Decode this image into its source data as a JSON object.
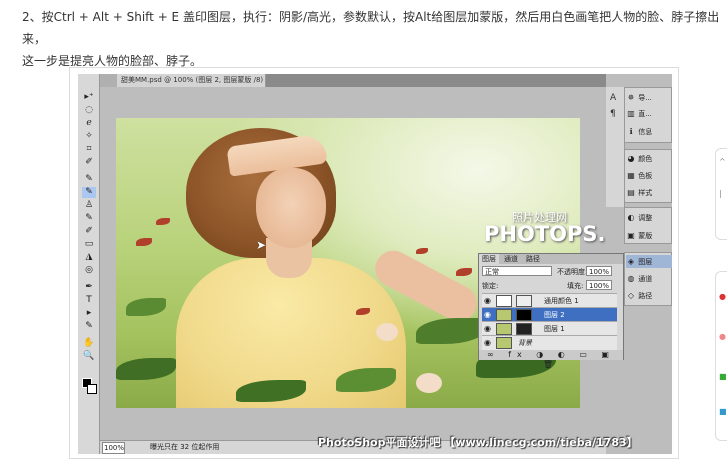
{
  "instruction": {
    "line1": "2、按Ctrl + Alt + Shift + E 盖印图层，执行：阴影/高光，参数默认，按Alt给图层加蒙版，然后用白色画笔把人物的脸、脖子擦出来，",
    "line2": "这一步是提亮人物的脸部、脖子。"
  },
  "document": {
    "tab_title": "甜美MM.psd @ 100% (图层 2, 图层蒙版 /8) * ×",
    "zoom": "100%",
    "status": "曝光只在 32 位起作用"
  },
  "toolbox": {
    "tools": [
      "▸⁺",
      "◌",
      "ℯ",
      "✧",
      "⌗",
      "✐",
      "✎",
      "✎",
      "♙",
      "✎",
      "✐",
      "▭",
      "◮",
      "◎",
      "✒",
      "T",
      "▸",
      "✎",
      "✋",
      "🔍"
    ]
  },
  "panels": {
    "mini": [
      "A",
      "¶"
    ],
    "group1": [
      {
        "icon": "✵",
        "label": "导..."
      },
      {
        "icon": "▥",
        "label": "直..."
      },
      {
        "icon": "ℹ",
        "label": "信息"
      }
    ],
    "group2": [
      {
        "icon": "◕",
        "label": "颜色"
      },
      {
        "icon": "▦",
        "label": "色板"
      },
      {
        "icon": "▤",
        "label": "样式"
      }
    ],
    "group3": [
      {
        "icon": "◐",
        "label": "调整"
      },
      {
        "icon": "▣",
        "label": "蒙版"
      }
    ],
    "group4": [
      {
        "icon": "◈",
        "label": "图层"
      },
      {
        "icon": "◍",
        "label": "通道"
      },
      {
        "icon": "◇",
        "label": "路径"
      }
    ]
  },
  "layers": {
    "tabs": [
      "图层",
      "通道",
      "路径"
    ],
    "blend_mode": "正常",
    "opacity_label": "不透明度:",
    "opacity_value": "100%",
    "lock_label": "锁定:",
    "fill_label": "填充:",
    "fill_value": "100%",
    "rows": [
      {
        "name": "通用颜色 1",
        "selected": false
      },
      {
        "name": "图层 2",
        "selected": true
      },
      {
        "name": "图层 1",
        "selected": false
      },
      {
        "name": "背景",
        "selected": false
      }
    ],
    "footer_icons": "∞ fx ◑ ◐ ▭ ▣ 🗑"
  },
  "watermarks": {
    "cn_top": "照片处理网",
    "photops": "PHOTOPS.COM",
    "bottom": "PhotoShop平面设计吧 【www.linecg.com/tieba/1783】"
  }
}
